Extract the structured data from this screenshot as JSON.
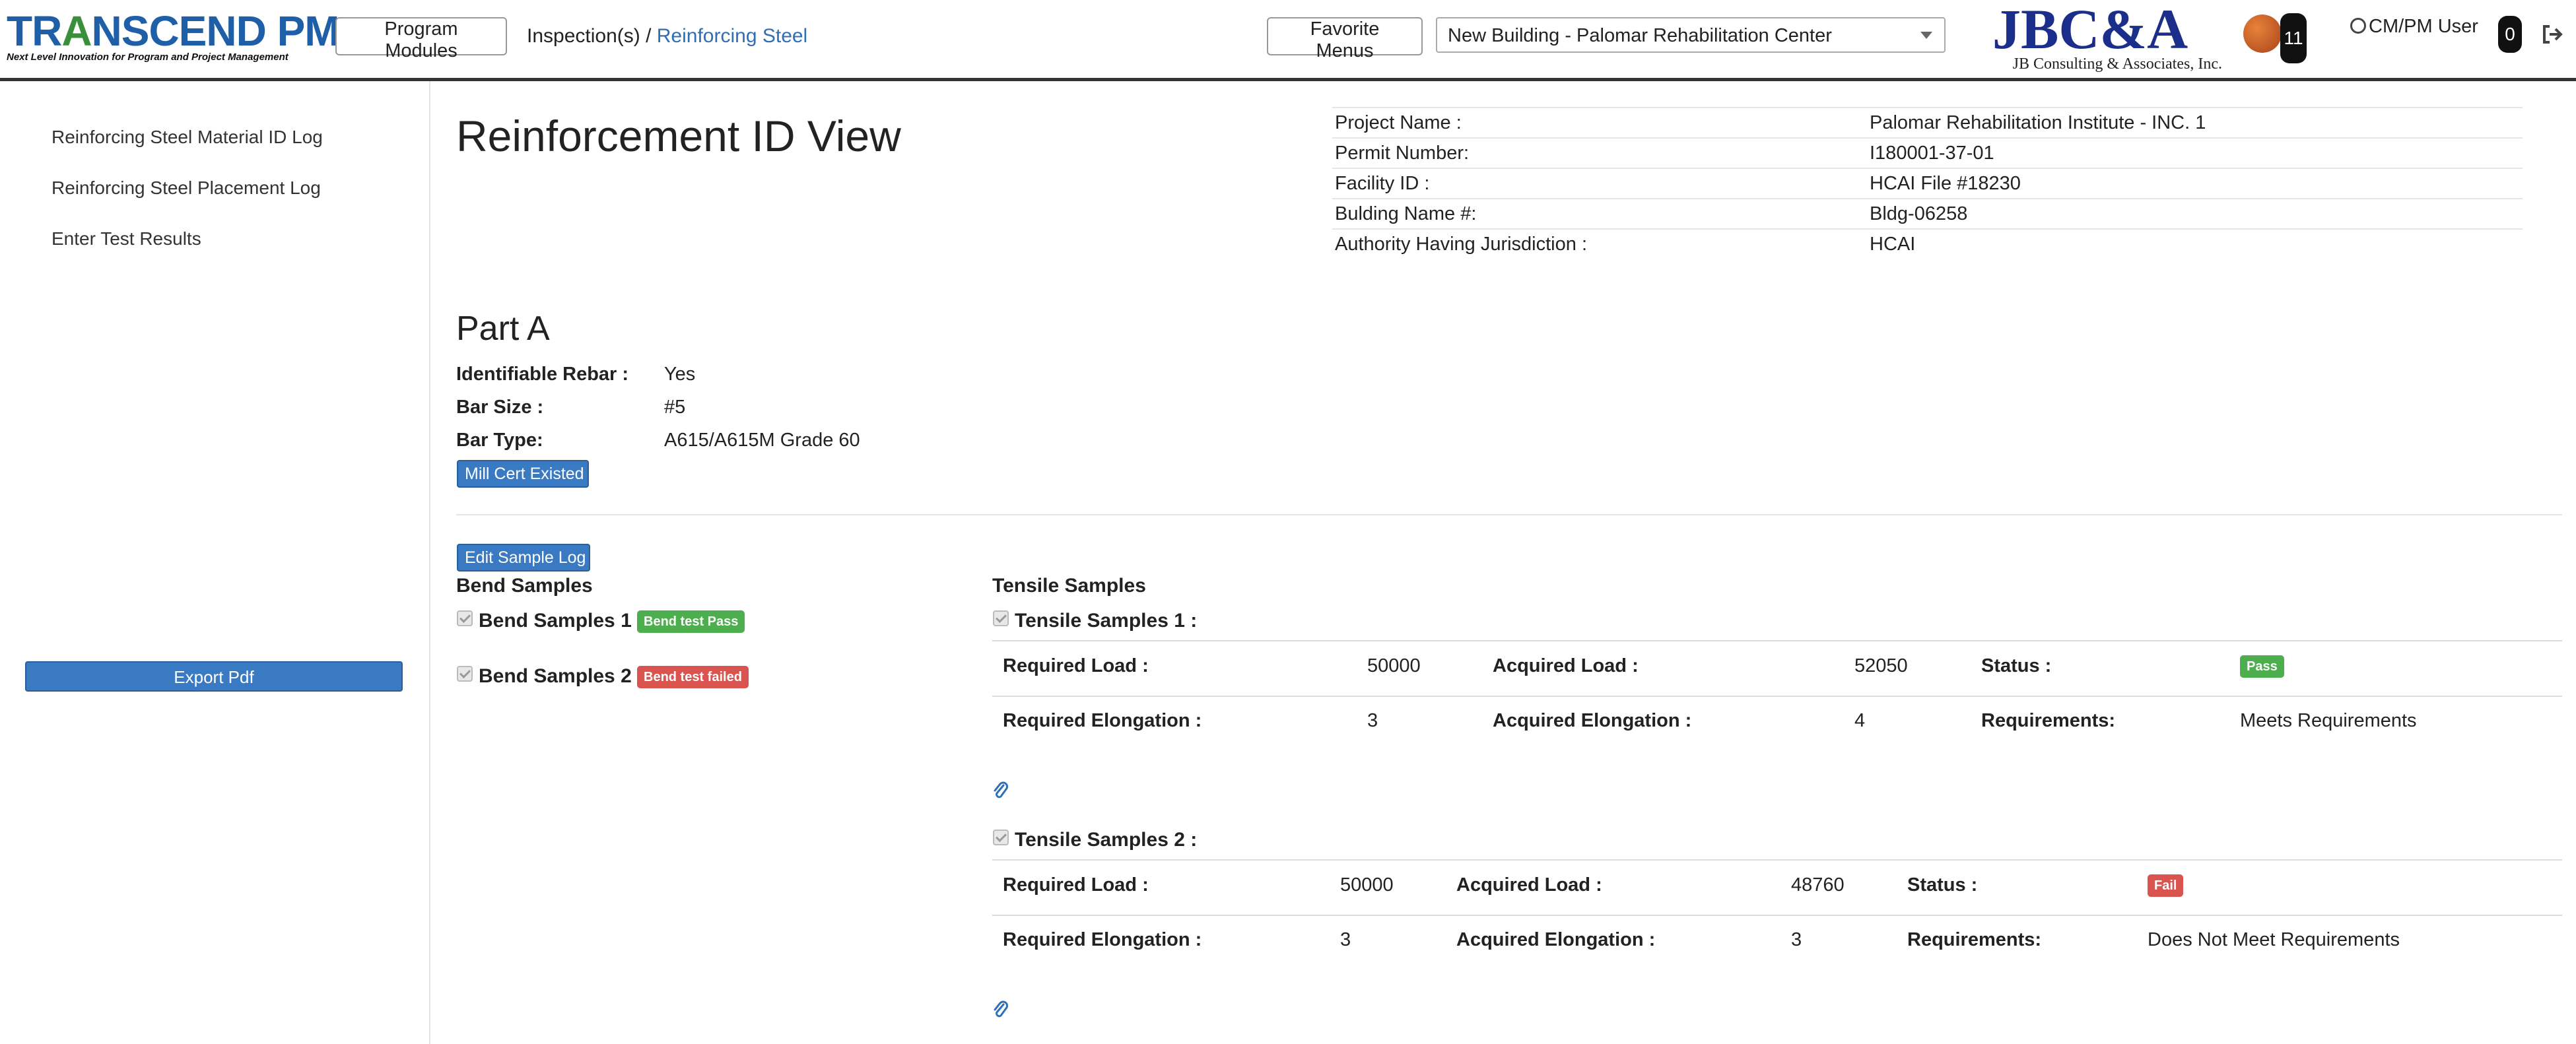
{
  "header": {
    "brand_title_pre": "TR",
    "brand_title_a": "A",
    "brand_title_post": "NSCEND PM",
    "brand_tagline": "Next Level Innovation for Program and Project Management",
    "program_modules_label": "Program Modules",
    "breadcrumb": {
      "parent": "Inspection(s)",
      "separator": " / ",
      "current": "Reinforcing Steel"
    },
    "favorite_menus_label": "Favorite Menus",
    "project_select_value": "New Building - Palomar Rehabilitation Center",
    "partner_logo_main": "JBC&A",
    "partner_logo_sub": "JB Consulting & Associates, Inc.",
    "notification_count": "11",
    "user_label": "CM/PM User",
    "message_count": "0",
    "icons": [
      "basketball-icon",
      "user-icon",
      "logout-icon"
    ]
  },
  "sidebar": {
    "items": [
      {
        "label": "Reinforcing Steel Material ID Log"
      },
      {
        "label": "Reinforcing Steel Placement Log"
      },
      {
        "label": "Enter Test Results"
      }
    ],
    "export_label": "Export Pdf"
  },
  "main": {
    "title": "Reinforcement ID View",
    "project_info": [
      {
        "label": "Project Name :",
        "value": "Palomar Rehabilitation Institute - INC. 1"
      },
      {
        "label": "Permit Number:",
        "value": "I180001-37-01"
      },
      {
        "label": "Facility ID :",
        "value": "HCAI File #18230"
      },
      {
        "label": "Bulding Name #:",
        "value": "Bldg-06258"
      },
      {
        "label": "Authority Having Jurisdiction :",
        "value": "HCAI"
      }
    ],
    "part_a": {
      "title": "Part A",
      "identifiable_rebar_label": "Identifiable Rebar :",
      "identifiable_rebar_value": "Yes",
      "bar_size_label": "Bar Size :",
      "bar_size_value": "#5",
      "bar_type_label": "Bar Type:",
      "bar_type_value": "A615/A615M Grade 60",
      "mill_cert_label": "Mill Cert Existed"
    },
    "edit_sample_log_label": "Edit Sample Log",
    "bend": {
      "title": "Bend Samples",
      "samples": [
        {
          "label": "Bend Samples 1 :",
          "status": "Bend test Pass",
          "status_color": "#4cae4c"
        },
        {
          "label": "Bend Samples 2 :",
          "status": "Bend test failed",
          "status_color": "#d9534f"
        }
      ]
    },
    "tensile": {
      "title": "Tensile Samples",
      "samples": [
        {
          "label": "Tensile Samples 1 :",
          "required_load_label": "Required Load :",
          "required_load": "50000",
          "acquired_load_label": "Acquired Load :",
          "acquired_load": "52050",
          "status_label": "Status :",
          "status": "Pass",
          "status_color": "#4cae4c",
          "required_elongation_label": "Required Elongation :",
          "required_elongation": "3",
          "acquired_elongation_label": "Acquired Elongation :",
          "acquired_elongation": "4",
          "requirements_label": "Requirements:",
          "requirements": "Meets Requirements"
        },
        {
          "label": "Tensile Samples 2 :",
          "required_load_label": "Required Load :",
          "required_load": "50000",
          "acquired_load_label": "Acquired Load :",
          "acquired_load": "48760",
          "status_label": "Status :",
          "status": "Fail",
          "status_color": "#d9534f",
          "required_elongation_label": "Required Elongation :",
          "required_elongation": "3",
          "acquired_elongation_label": "Acquired Elongation :",
          "acquired_elongation": "3",
          "requirements_label": "Requirements:",
          "requirements": "Does Not Meet Requirements"
        }
      ]
    }
  }
}
